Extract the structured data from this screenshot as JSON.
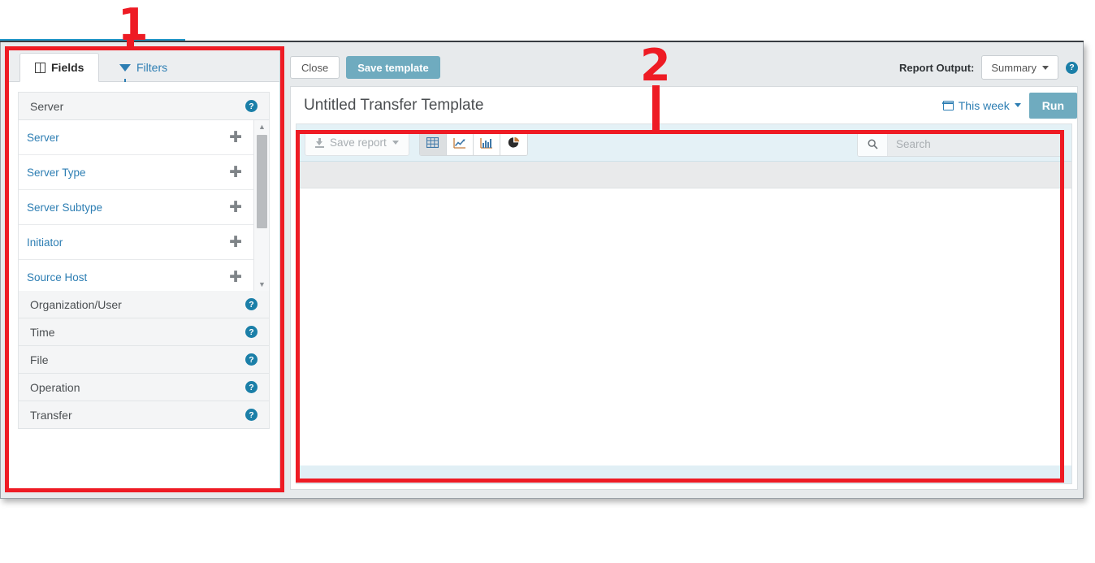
{
  "window": {
    "accent_color": "#2196c9",
    "chrome_color": "#e7eaec"
  },
  "left_panel": {
    "tabs": [
      {
        "label": "Fields",
        "icon": "columns-icon",
        "active": true
      },
      {
        "label": "Filters",
        "icon": "funnel-icon",
        "active": false
      }
    ],
    "group_open": {
      "label": "Server",
      "help_icon": "help-circle-icon",
      "help_glyph": "?"
    },
    "fields": [
      {
        "label": "Server",
        "action_icon": "plus-icon",
        "action_glyph": "✚"
      },
      {
        "label": "Server Type",
        "action_icon": "plus-icon",
        "action_glyph": "✚"
      },
      {
        "label": "Server Subtype",
        "action_icon": "plus-icon",
        "action_glyph": "✚"
      },
      {
        "label": "Initiator",
        "action_icon": "plus-icon",
        "action_glyph": "✚"
      },
      {
        "label": "Source Host",
        "action_icon": "plus-icon",
        "action_glyph": "✚"
      }
    ],
    "scrollbar": {
      "up_glyph": "▲",
      "down_glyph": "▼"
    },
    "groups": [
      {
        "label": "Organization/User",
        "help_glyph": "?"
      },
      {
        "label": "Time",
        "help_glyph": "?"
      },
      {
        "label": "File",
        "help_glyph": "?"
      },
      {
        "label": "Operation",
        "help_glyph": "?"
      },
      {
        "label": "Transfer",
        "help_glyph": "?"
      }
    ]
  },
  "action_bar": {
    "close_label": "Close",
    "save_template_label": "Save template",
    "save_template_color": "#6fabbf",
    "report_output_label": "Report Output:",
    "report_output_value": "Summary",
    "help_glyph": "?"
  },
  "report_card": {
    "title": "Untitled Transfer Template",
    "date_range_label": "This week",
    "date_range_icon": "calendar-icon",
    "run_label": "Run",
    "run_color": "#6fabbf"
  },
  "inner_toolbar": {
    "save_report_label": "Save report",
    "save_report_icon": "download-icon",
    "views": [
      {
        "name": "table-view",
        "icon": "table-icon",
        "active": true
      },
      {
        "name": "line-view",
        "icon": "line-chart-icon",
        "active": false
      },
      {
        "name": "bar-view",
        "icon": "bar-chart-icon",
        "active": false
      },
      {
        "name": "pie-view",
        "icon": "pie-chart-icon",
        "active": false
      }
    ],
    "search": {
      "placeholder": "Search",
      "value": "",
      "icon": "search-icon"
    }
  },
  "annotations": [
    {
      "number": "1",
      "target": "fields-and-filters-panel"
    },
    {
      "number": "2",
      "target": "report-preview-area"
    }
  ]
}
